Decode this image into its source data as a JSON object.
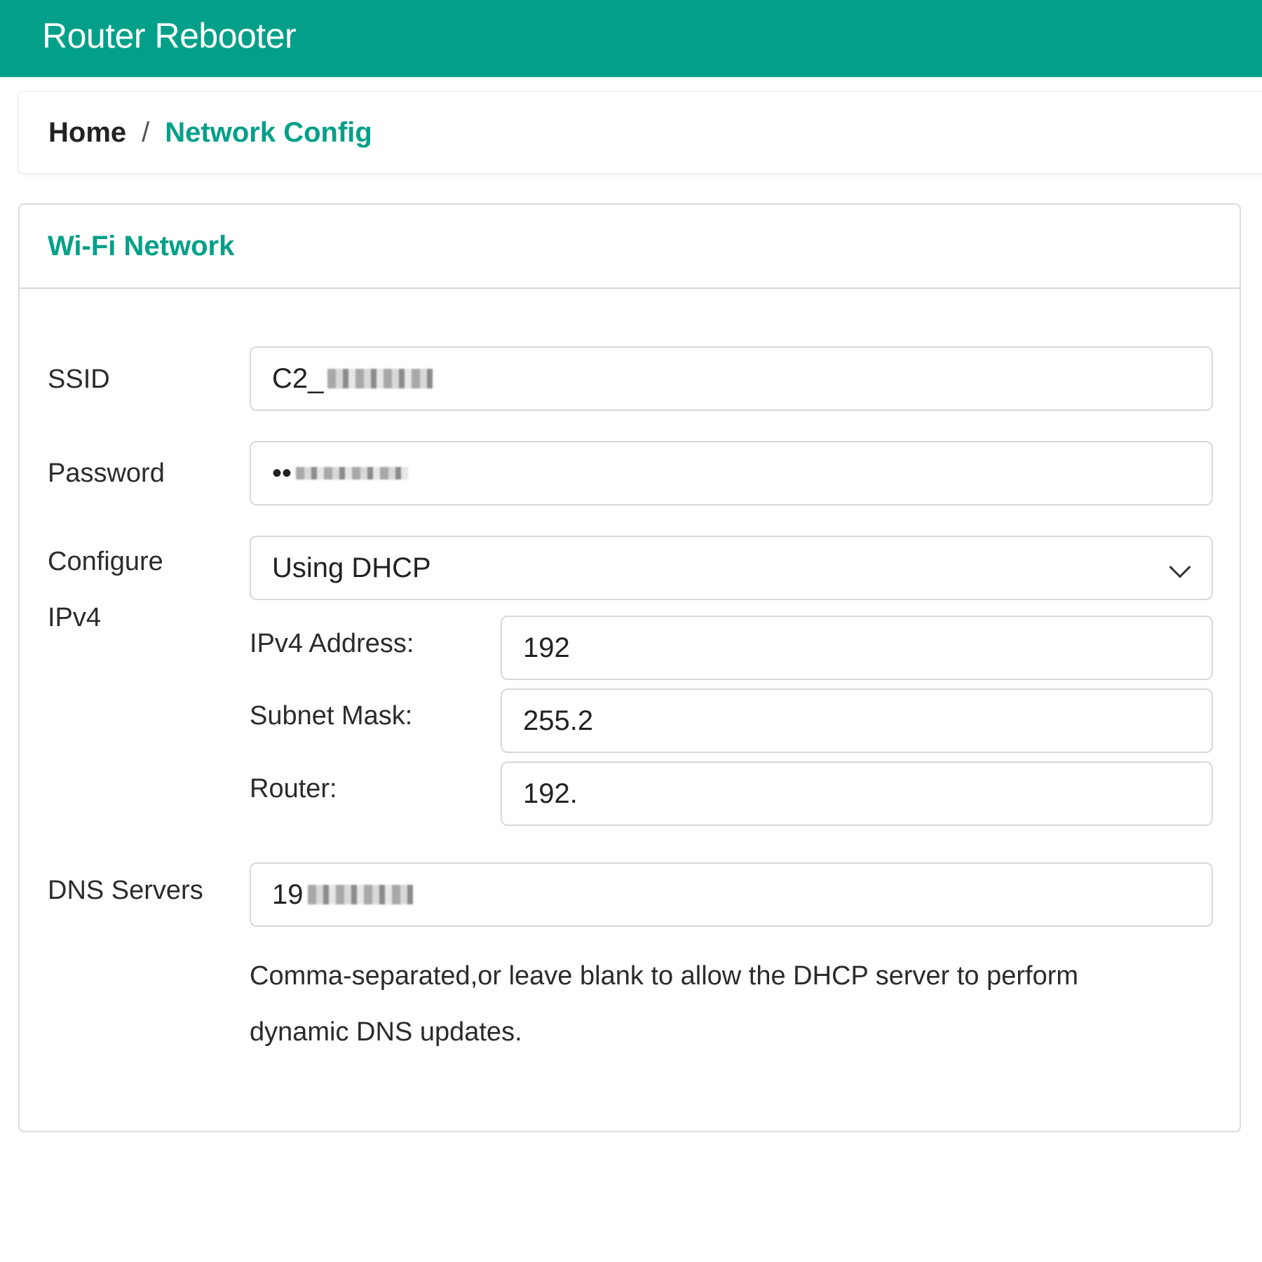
{
  "app": {
    "title": "Router Rebooter"
  },
  "breadcrumb": {
    "home": "Home",
    "separator": "/",
    "current": "Network Config"
  },
  "card": {
    "title": "Wi-Fi Network",
    "ssid": {
      "label": "SSID",
      "value": "C2_"
    },
    "password": {
      "label": "Password",
      "value": "••"
    },
    "ipv4": {
      "label_line1": "Configure",
      "label_line2": "IPv4",
      "selected": "Using DHCP",
      "address": {
        "label": "IPv4 Address:",
        "value": "192"
      },
      "subnet": {
        "label": "Subnet Mask:",
        "value": "255.2"
      },
      "router": {
        "label": "Router:",
        "value": "192."
      }
    },
    "dns": {
      "label": "DNS Servers",
      "value": "19",
      "help": "Comma-separated,or leave blank to allow the DHCP server to perform dynamic DNS updates."
    }
  },
  "colors": {
    "accent": "#02a088"
  },
  "icons": {
    "select": "chevron-down-icon"
  }
}
